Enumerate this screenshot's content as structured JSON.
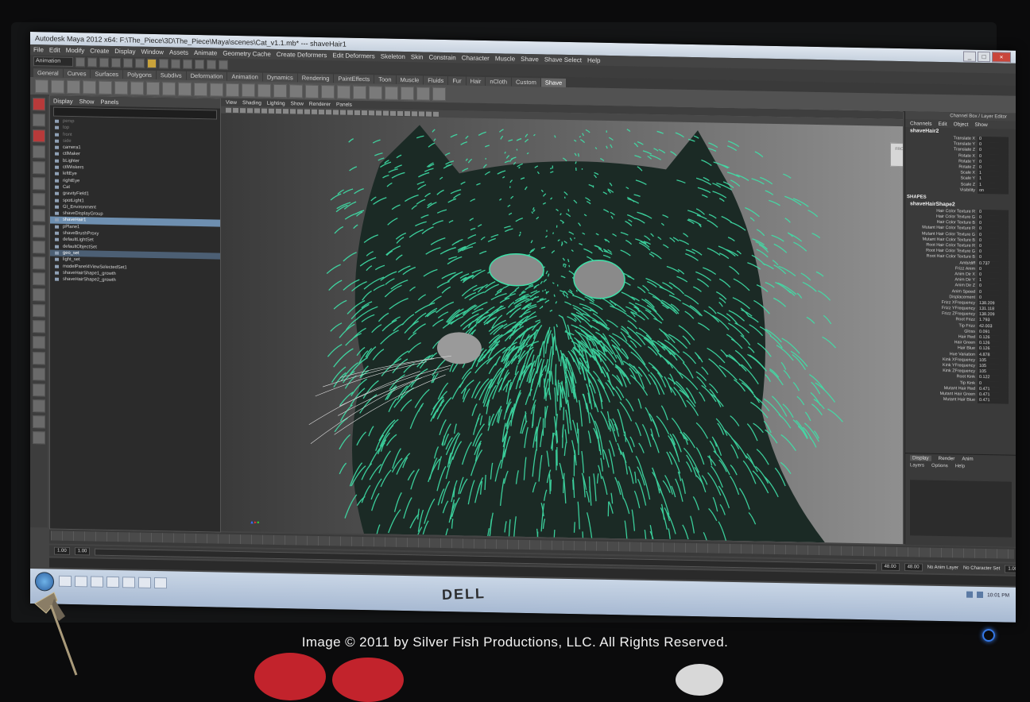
{
  "window": {
    "title": "Autodesk Maya 2012 x64: F:\\The_Piece\\3D\\The_Piece\\Maya\\scenes\\Cat_v1.1.mb* --- shaveHair1",
    "controls": [
      "_",
      "□",
      "×"
    ]
  },
  "menubar": [
    "File",
    "Edit",
    "Modify",
    "Create",
    "Display",
    "Window",
    "Assets",
    "Animate",
    "Geometry Cache",
    "Create Deformers",
    "Edit Deformers",
    "Skeleton",
    "Skin",
    "Constrain",
    "Character",
    "Muscle",
    "Shave",
    "Shave Select",
    "Help"
  ],
  "status_line": {
    "mode": "Animation"
  },
  "shelf_tabs": [
    "General",
    "Curves",
    "Surfaces",
    "Polygons",
    "Subdivs",
    "Deformation",
    "Animation",
    "Dynamics",
    "Rendering",
    "PaintEffects",
    "Toon",
    "Muscle",
    "Fluids",
    "Fur",
    "Hair",
    "nCloth",
    "Custom",
    "Shave"
  ],
  "shelf_active": "Shave",
  "outliner": {
    "menu": [
      "Display",
      "Show",
      "Panels"
    ],
    "items": [
      {
        "label": "persp",
        "state": "dim"
      },
      {
        "label": "top",
        "state": "dim"
      },
      {
        "label": "front",
        "state": "dim"
      },
      {
        "label": "side",
        "state": "dim"
      },
      {
        "label": "camera1",
        "state": ""
      },
      {
        "label": "ctlMaker",
        "state": ""
      },
      {
        "label": "bLighter",
        "state": ""
      },
      {
        "label": "ctlWiskers",
        "state": ""
      },
      {
        "label": "leftEye",
        "state": ""
      },
      {
        "label": "rightEye",
        "state": ""
      },
      {
        "label": "Cat",
        "state": ""
      },
      {
        "label": "gravityField1",
        "state": ""
      },
      {
        "label": "spotLight1",
        "state": ""
      },
      {
        "label": "GI_Environment",
        "state": ""
      },
      {
        "label": "shaveDisplayGroup",
        "state": ""
      },
      {
        "label": "shaveHair1",
        "state": "sel"
      },
      {
        "label": "pPlane1",
        "state": ""
      },
      {
        "label": "shaveBrushProxy",
        "state": ""
      },
      {
        "label": "defaultLightSet",
        "state": ""
      },
      {
        "label": "defaultObjectSet",
        "state": ""
      },
      {
        "label": "geo_set",
        "state": "sel2"
      },
      {
        "label": "light_set",
        "state": ""
      },
      {
        "label": "modelPanel4ViewSelectedSet1",
        "state": ""
      },
      {
        "label": "shaveHairShape1_growth",
        "state": ""
      },
      {
        "label": "shaveHairShape2_growth",
        "state": ""
      }
    ]
  },
  "viewport": {
    "menu": [
      "View",
      "Shading",
      "Lighting",
      "Show",
      "Renderer",
      "Panels"
    ],
    "viewcube_label": "FRONT",
    "hair_color": "#3fe0a8"
  },
  "channel_box": {
    "header": "Channel Box / Layer Editor",
    "menu": [
      "Channels",
      "Edit",
      "Object",
      "Show"
    ],
    "node": "shaveHair2",
    "transform": [
      {
        "k": "Translate X",
        "v": "0"
      },
      {
        "k": "Translate Y",
        "v": "0"
      },
      {
        "k": "Translate Z",
        "v": "0"
      },
      {
        "k": "Rotate X",
        "v": "0"
      },
      {
        "k": "Rotate Y",
        "v": "0"
      },
      {
        "k": "Rotate Z",
        "v": "0"
      },
      {
        "k": "Scale X",
        "v": "1"
      },
      {
        "k": "Scale Y",
        "v": "1"
      },
      {
        "k": "Scale Z",
        "v": "1"
      },
      {
        "k": "Visibility",
        "v": "on"
      }
    ],
    "shapes_label": "SHAPES",
    "shape_node": "shaveHairShape2",
    "shape_attrs": [
      {
        "k": "Hair Color Texture R",
        "v": "0"
      },
      {
        "k": "Hair Color Texture G",
        "v": "0"
      },
      {
        "k": "Hair Color Texture B",
        "v": "0"
      },
      {
        "k": "Mutant Hair Color Texture R",
        "v": "0"
      },
      {
        "k": "Mutant Hair Color Texture G",
        "v": "0"
      },
      {
        "k": "Mutant Hair Color Texture B",
        "v": "0"
      },
      {
        "k": "Root Hair Color Texture R",
        "v": "0"
      },
      {
        "k": "Root Hair Color Texture G",
        "v": "0"
      },
      {
        "k": "Root Hair Color Texture B",
        "v": "0"
      },
      {
        "k": "Amb/diff",
        "v": "0.737"
      },
      {
        "k": "Frizz Anim",
        "v": "0"
      },
      {
        "k": "Anim Dir X",
        "v": "0"
      },
      {
        "k": "Anim Dir Y",
        "v": "1"
      },
      {
        "k": "Anim Dir Z",
        "v": "0"
      },
      {
        "k": "Anim Speed",
        "v": "0"
      },
      {
        "k": "Displacement",
        "v": "0"
      },
      {
        "k": "Frizz XFrequency",
        "v": "138.209"
      },
      {
        "k": "Frizz YFrequency",
        "v": "131.118"
      },
      {
        "k": "Frizz ZFrequency",
        "v": "138.209"
      },
      {
        "k": "Root Frizz",
        "v": "1.793"
      },
      {
        "k": "Tip Frizz",
        "v": "42.003"
      },
      {
        "k": "Gloss",
        "v": "0.091"
      },
      {
        "k": "Hair Red",
        "v": "0.126"
      },
      {
        "k": "Hair Green",
        "v": "0.126"
      },
      {
        "k": "Hair Blue",
        "v": "0.126"
      },
      {
        "k": "Hue Variation",
        "v": "4.878"
      },
      {
        "k": "Kink XFrequency",
        "v": "105"
      },
      {
        "k": "Kink YFrequency",
        "v": "105"
      },
      {
        "k": "Kink ZFrequency",
        "v": "105"
      },
      {
        "k": "Root Kink",
        "v": "0.122"
      },
      {
        "k": "Tip Kink",
        "v": "0"
      },
      {
        "k": "Mutant Hair Red",
        "v": "0.471"
      },
      {
        "k": "Mutant Hair Green",
        "v": "0.471"
      },
      {
        "k": "Mutant Hair Blue",
        "v": "0.471"
      }
    ]
  },
  "layer_editor": {
    "tabs": [
      "Display",
      "Render",
      "Anim"
    ],
    "menu": [
      "Layers",
      "Options",
      "Help"
    ]
  },
  "range": {
    "start": "1.00",
    "start2": "1.00",
    "end": "48.00",
    "end2": "48.00",
    "current_frame": "1.00",
    "anim_layer": "No Anim Layer",
    "char_set": "No Character Set"
  },
  "taskbar": {
    "clock": "10:01 PM"
  },
  "monitor_brand": "DELL",
  "copyright": "Image © 2011 by Silver Fish Productions, LLC.  All Rights Reserved."
}
